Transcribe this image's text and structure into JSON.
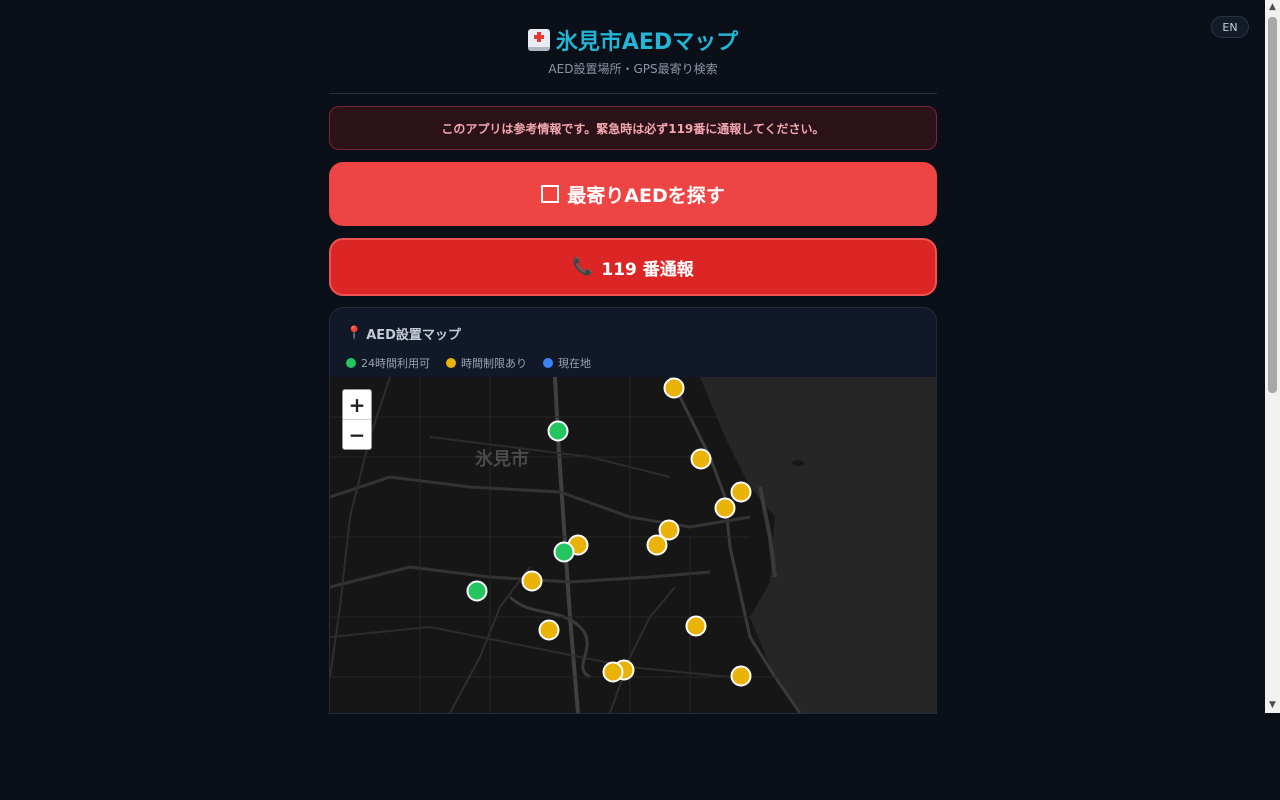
{
  "lang_button": "EN",
  "header": {
    "icon": "hospital-icon",
    "title": "氷見市AEDマップ",
    "subtitle": "AED設置場所・GPS最寄り検索"
  },
  "alert": {
    "text": "このアプリは参考情報です。緊急時は必ず119番に通報してください。"
  },
  "find_button": {
    "icon": "sos-icon",
    "label": "最寄りAEDを探す"
  },
  "call_button": {
    "icon": "phone-icon",
    "label": "119 番通報"
  },
  "map": {
    "icon": "pin-icon",
    "title": "AED設置マップ",
    "legend": [
      {
        "label": "24時間利用可",
        "color": "#22c55e"
      },
      {
        "label": "時間制限あり",
        "color": "#eab308"
      },
      {
        "label": "現在地",
        "color": "#3b82f6"
      }
    ],
    "zoom_in": "+",
    "zoom_out": "−",
    "place_label": "氷見市"
  },
  "colors": {
    "accent": "#22b5d6",
    "danger": "#ef4444",
    "marker_24h": "#22c55e",
    "marker_limited": "#eab308"
  }
}
